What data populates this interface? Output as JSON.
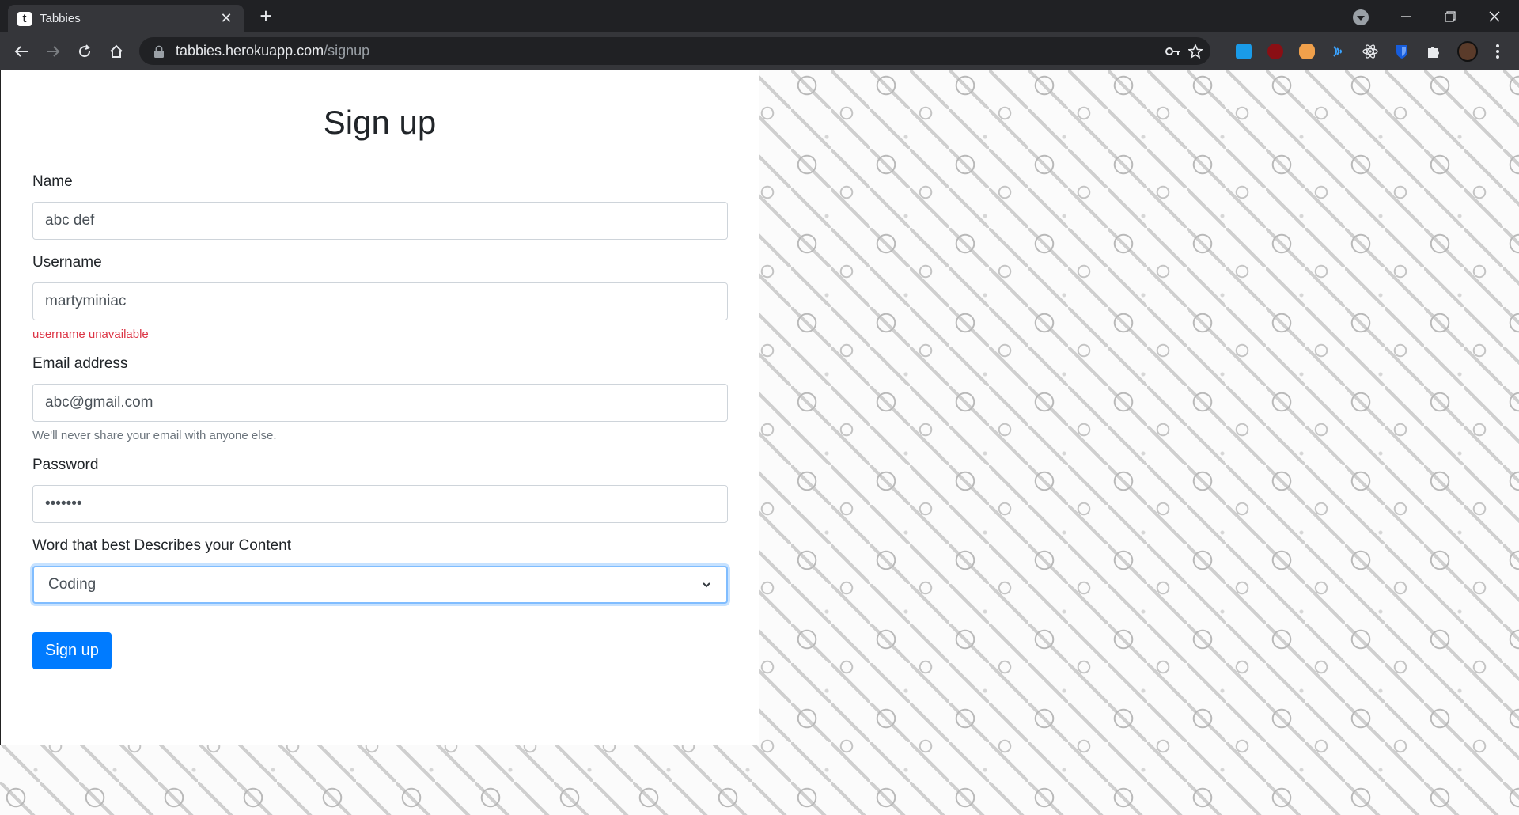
{
  "browser": {
    "tab": {
      "favicon_letter": "t",
      "title": "Tabbies",
      "close": "✕"
    },
    "new_tab": "+",
    "url_host": "tabbies.herokuapp.com",
    "url_path": "/signup"
  },
  "form": {
    "title": "Sign up",
    "name": {
      "label": "Name",
      "value": "abc def"
    },
    "username": {
      "label": "Username",
      "value": "martyminiac",
      "error": "username unavailable"
    },
    "email": {
      "label": "Email address",
      "value": "abc@gmail.com",
      "help": "We'll never share your email with anyone else."
    },
    "password": {
      "label": "Password",
      "masked_value": "•••••••"
    },
    "content_word": {
      "label": "Word that best Describes your Content",
      "selected": "Coding"
    },
    "submit_label": "Sign up"
  },
  "colors": {
    "primary": "#007bff",
    "error": "#dc3545",
    "muted": "#6c757d",
    "chrome_dark": "#202124"
  }
}
